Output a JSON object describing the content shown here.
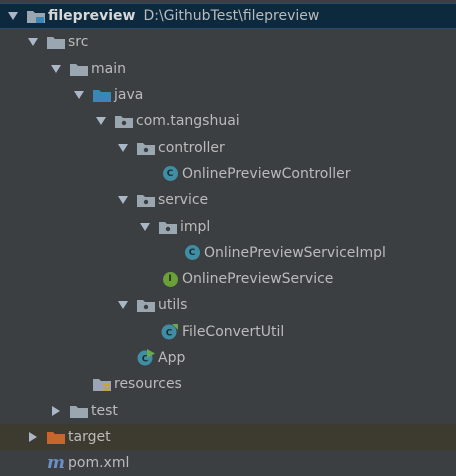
{
  "project": {
    "name": "filepreview",
    "path": "D:\\GithubTest\\filepreview"
  },
  "tree": {
    "src": "src",
    "main": "main",
    "java": "java",
    "package": "com.tangshuai",
    "controller": "controller",
    "controller_class": "OnlinePreviewController",
    "service": "service",
    "impl": "impl",
    "impl_class": "OnlinePreviewServiceImpl",
    "service_interface": "OnlinePreviewService",
    "utils": "utils",
    "utils_class": "FileConvertUtil",
    "app": "App",
    "resources": "resources",
    "test": "test",
    "target": "target",
    "pom": "pom.xml"
  },
  "colors": {
    "background": "#3c3f41",
    "selection": "#0d293e",
    "excluded_row": "#3d3a2f",
    "source_folder": "#3a86b4",
    "excluded_folder": "#c9652a",
    "folder": "#9aa7b0"
  }
}
